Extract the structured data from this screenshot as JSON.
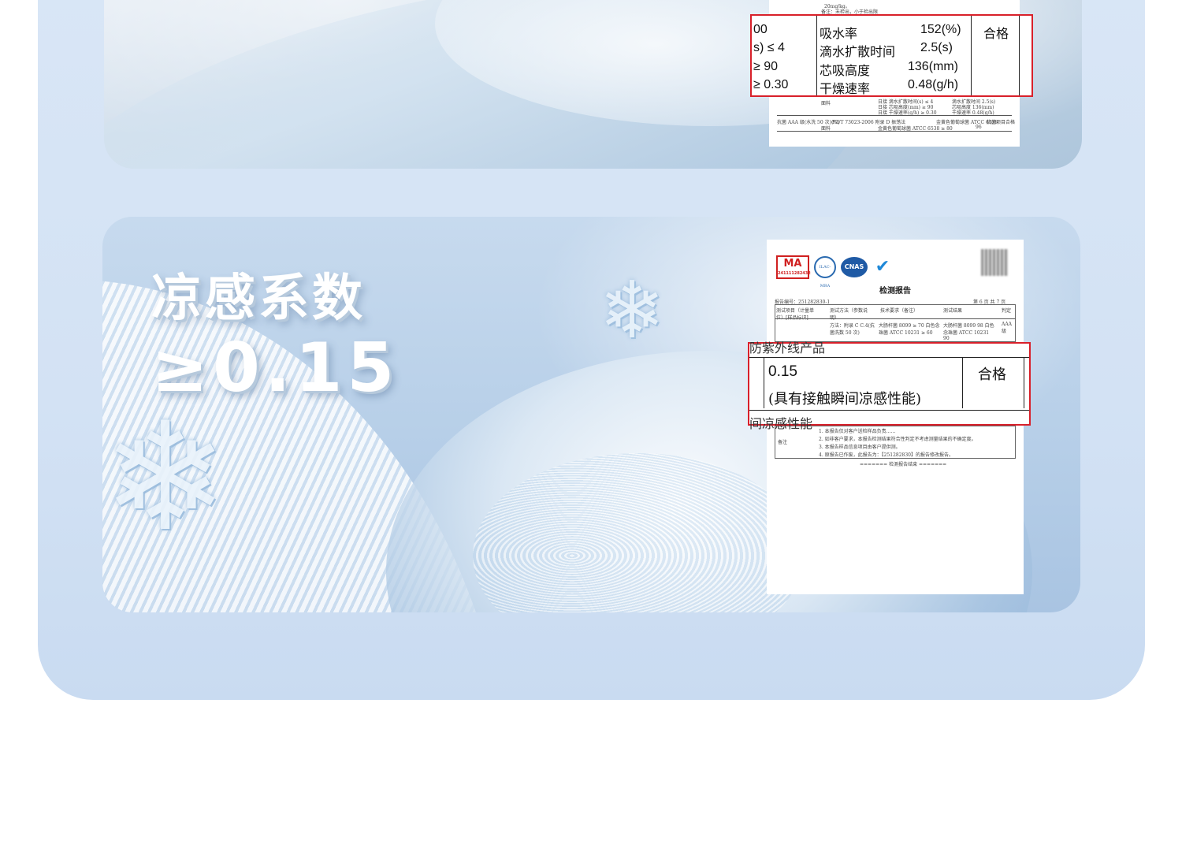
{
  "cards": {
    "cooling": {
      "title": "凉感系数",
      "value": "≥0.15"
    }
  },
  "report_top_zoom": {
    "rows": [
      {
        "left": "00",
        "item": "吸水率",
        "value": "152(%)"
      },
      {
        "left": "s) ≤ 4",
        "item": "滴水扩散时间",
        "value": "2.5(s)"
      },
      {
        "left": "≥ 90",
        "item": "芯吸高度",
        "value": "136(mm)"
      },
      {
        "left": "≥ 0.30",
        "item": "干燥速率",
        "value": "0.48(g/h)"
      }
    ],
    "verdict": "合格"
  },
  "report_top_doc": {
    "lines": [
      "20mg/kg。",
      "备注：未检出，小于检出限",
      "面料",
      "日接 滴水扩散时间(s) ≤ 4",
      "日接 芯吸高度(mm) ≥ 90",
      "日接 干燥速率(g/h) ≥ 0.30",
      "滴水扩散时间 2.5(s)",
      "芯吸高度 136(mm)",
      "干燥速率 0.48(g/h)",
      "抗菌 AAA 级(水洗 50 次)(%)",
      "面料",
      "FZ/T 73023-2006 附录 D 振荡法",
      "金黄色葡萄球菌 ATCC 6538 ≥ 80",
      "金黄色葡萄球菌 ATCC 6538",
      "96",
      "抗菌项目合格"
    ]
  },
  "report_bottom_doc": {
    "header_left": "报告编号：251282830-1",
    "header_right": "第 6 页 共 7 页",
    "title": "检测报告",
    "logos": {
      "ma": "MA",
      "ma_number": "241111282432",
      "ilac": "ILAC-MRA",
      "cnas": "CNAS"
    },
    "table_header": [
      "测试项目（计量单位）[样品标识]",
      "测试方法（参数说明）",
      "技术要求（备注）",
      "测试结果",
      "判定"
    ],
    "table_row": [
      "方法：附录 C C.4(抗菌洗数 50 次)",
      "大肠杆菌 8099 ≥ 70 白色念珠菌 ATCC 10231 ≥ 60",
      "大肠杆菌 8099 98 白色念珠菌 ATCC 10231 90",
      "AAA 级"
    ],
    "remarks_label": "备注",
    "remarks": [
      "1. 本报告仅对客户送检样品负责……",
      "2. 如非客户要求，本报告检测结果符合性判定不考虑测量结果的不确定度。",
      "3. 本报告样品信息项目由客户提供测。",
      "4. 原报告已作废，此报告为：【251282830】的报告修改报告。"
    ],
    "end": "======= 检测报告结束 ======="
  },
  "report_bottom_zoom": {
    "above_text": "防紫外线产品",
    "value_line1": "0.15",
    "value_line2": "(具有接触瞬间凉感性能)",
    "verdict": "合格",
    "below_text": "间凉感性能"
  },
  "colors": {
    "accent_red": "#d8202a",
    "panel_blue": "#d3e2f4",
    "cnas_blue": "#1f5aa5"
  }
}
